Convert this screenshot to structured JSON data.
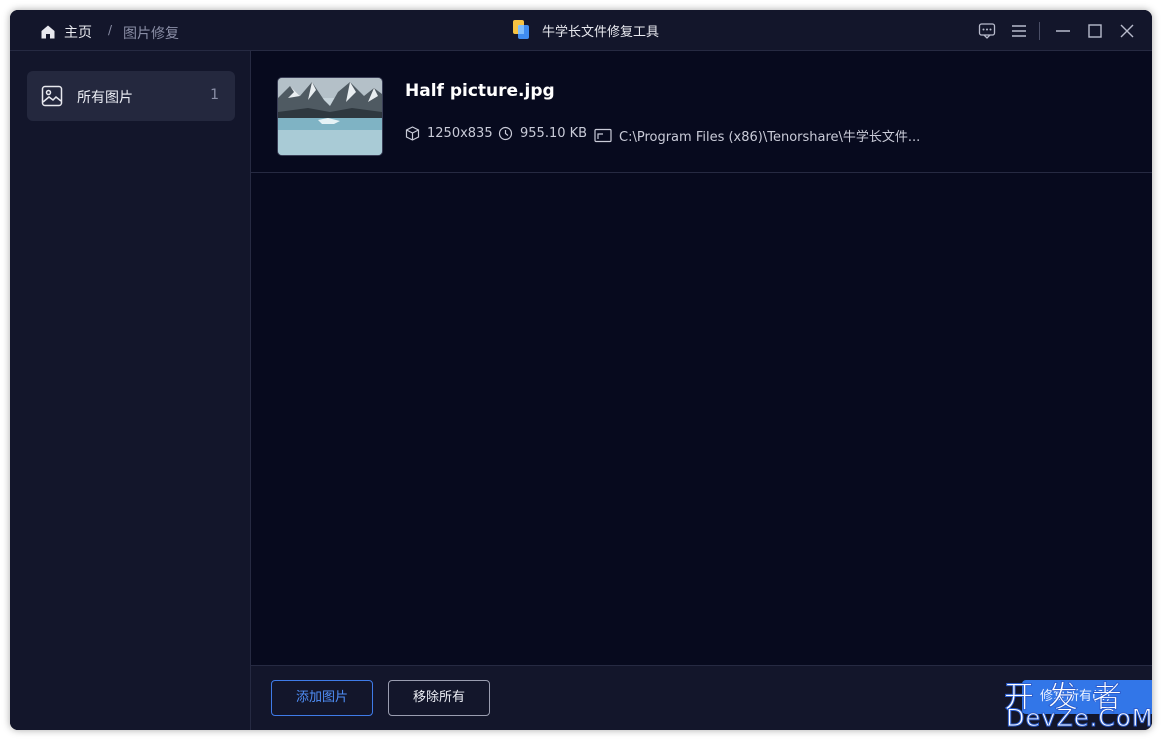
{
  "titlebar": {
    "breadcrumb_home": "主页",
    "breadcrumb_separator": "/",
    "breadcrumb_current": "图片修复",
    "app_title": "牛学长文件修复工具",
    "icons": [
      "feedback-icon",
      "menu-icon",
      "minimize-icon",
      "maximize-icon",
      "close-icon"
    ]
  },
  "sidebar": {
    "items": [
      {
        "label": "所有图片",
        "count": "1",
        "icon": "image-icon"
      }
    ]
  },
  "files": [
    {
      "name": "Half picture.jpg",
      "dimensions": "1250x835",
      "size": "955.10 KB",
      "path": "C:\\Program Files (x86)\\Tenorshare\\牛学长文件..."
    }
  ],
  "footer": {
    "add_label": "添加图片",
    "remove_label": "移除所有",
    "repair_label": "修复所有(1)"
  },
  "watermark": {
    "top": "开发者",
    "bottom": "DevZe.CoM"
  },
  "colors": {
    "accent": "#3276e8",
    "background": "#070a1e",
    "panel": "#13162b"
  }
}
